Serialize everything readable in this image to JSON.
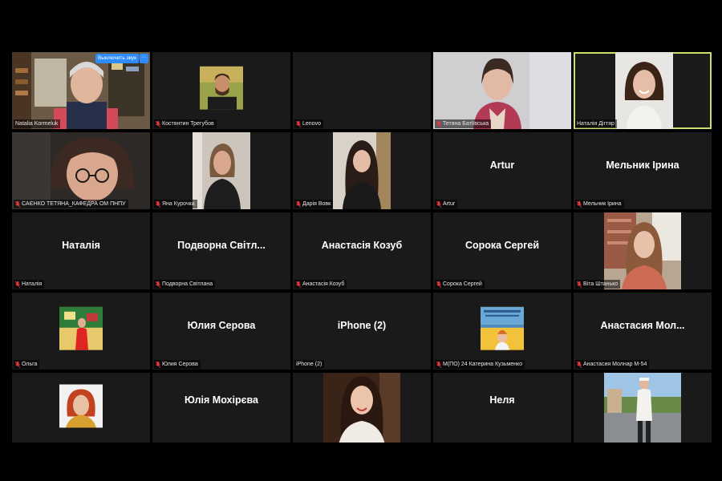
{
  "colors": {
    "background": "#000000",
    "tile": "#1a1a1a",
    "active_border": "#c9e265",
    "muted_icon": "#e0393e",
    "button": "#2d8cff"
  },
  "icons": {
    "muted": "mic-muted-icon",
    "more": "more-icon"
  },
  "controls": {
    "unmute_label": "Выключить звук",
    "more_label": "···"
  },
  "tiles": [
    {
      "name": "Natalia Kormeluk",
      "video": true,
      "muted": false
    },
    {
      "name": "Костянтин Трегубов",
      "video": true,
      "muted": true
    },
    {
      "name": "Lenovo",
      "video": false,
      "display": "",
      "muted": true
    },
    {
      "name": "Тетяна Батіївська",
      "video": true,
      "muted": true
    },
    {
      "name": "Наталія Дігтяр",
      "video": true,
      "muted": false,
      "active": true
    },
    {
      "name": "САЄНКО ТЕТЯНА_КАФЕДРА ОМ ПНПУ",
      "video": true,
      "muted": true
    },
    {
      "name": "Яна Курочка",
      "video": true,
      "muted": true
    },
    {
      "name": "Дарія Вовк",
      "video": true,
      "muted": true
    },
    {
      "name": "Artur",
      "video": false,
      "display": "Artur",
      "muted": true
    },
    {
      "name": "Мельник Ірина",
      "video": false,
      "display": "Мельник Ірина",
      "muted": true
    },
    {
      "name": "Наталія",
      "video": false,
      "display": "Наталія",
      "muted": true
    },
    {
      "name": "Подворна Світлана",
      "video": false,
      "display": "Подворна  Світл...",
      "muted": true
    },
    {
      "name": "Анастасія Козуб",
      "video": false,
      "display": "Анастасія Козуб",
      "muted": true
    },
    {
      "name": "Сорока Сергей",
      "video": false,
      "display": "Сорока Сергей",
      "muted": true
    },
    {
      "name": "Віта Штанько",
      "video": true,
      "muted": true
    },
    {
      "name": "Ольга",
      "video": true,
      "muted": true
    },
    {
      "name": "Юлия Серова",
      "video": false,
      "display": "Юлия Серова",
      "muted": true
    },
    {
      "name": "iPhone (2)",
      "video": false,
      "display": "iPhone (2)",
      "muted": false
    },
    {
      "name": "М(ПО) 24 Катерина  Кузьменко",
      "video": true,
      "muted": true
    },
    {
      "name": "Анастасия Молнар М-54",
      "video": false,
      "display": "Анастасия  Мол...",
      "muted": true
    },
    {
      "name": "",
      "video": true,
      "muted": false
    },
    {
      "name": "",
      "video": false,
      "display": "Юлія Мохірєва",
      "muted": false
    },
    {
      "name": "",
      "video": true,
      "muted": false
    },
    {
      "name": "",
      "video": false,
      "display": "Неля",
      "muted": false
    },
    {
      "name": "",
      "video": true,
      "muted": false
    }
  ]
}
